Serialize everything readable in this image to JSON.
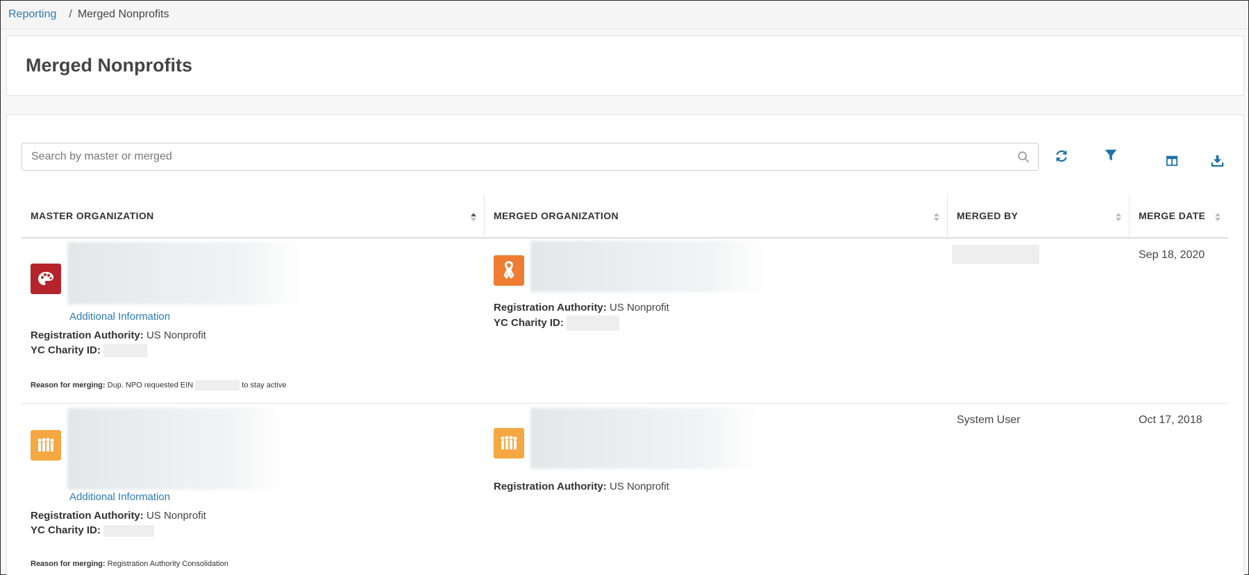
{
  "breadcrumb": {
    "parent": "Reporting",
    "separator": "/",
    "current": "Merged Nonprofits"
  },
  "page": {
    "title": "Merged Nonprofits"
  },
  "search": {
    "placeholder": "Search by master or merged",
    "value": ""
  },
  "toolbar": {
    "refresh_icon": "refresh-icon",
    "filter_icon": "filter-icon",
    "columns_icon": "columns-icon",
    "download_icon": "download-icon"
  },
  "colors": {
    "accent": "#2b7bb5",
    "icon_red": "#b5242b",
    "icon_orange": "#ef7d31",
    "icon_amber": "#f5a742"
  },
  "table": {
    "columns": [
      "MASTER ORGANIZATION",
      "MERGED ORGANIZATION",
      "MERGED BY",
      "MERGE DATE"
    ],
    "rows": [
      {
        "master": {
          "icon": "palette-icon",
          "additional_info": "Additional Information",
          "authority_label": "Registration Authority:",
          "authority_value": "US Nonprofit",
          "charity_label": "YC Charity ID:"
        },
        "merged": {
          "icon": "ribbon-icon",
          "authority_label": "Registration Authority:",
          "authority_value": "US Nonprofit",
          "charity_label": "YC Charity ID:"
        },
        "merged_by": "",
        "merge_date": "Sep 18, 2020",
        "reason_label": "Reason for merging:",
        "reason_prefix": "Dup. NPO requested EIN",
        "reason_suffix": "to stay active"
      },
      {
        "master": {
          "icon": "people-icon",
          "additional_info": "Additional Information",
          "authority_label": "Registration Authority:",
          "authority_value": "US Nonprofit",
          "charity_label": "YC Charity ID:"
        },
        "merged": {
          "icon": "people-icon",
          "authority_label": "Registration Authority:",
          "authority_value": "US Nonprofit"
        },
        "merged_by": "System User",
        "merge_date": "Oct 17, 2018",
        "reason_label": "Reason for merging:",
        "reason_text": "Registration Authority Consolidation"
      }
    ]
  }
}
